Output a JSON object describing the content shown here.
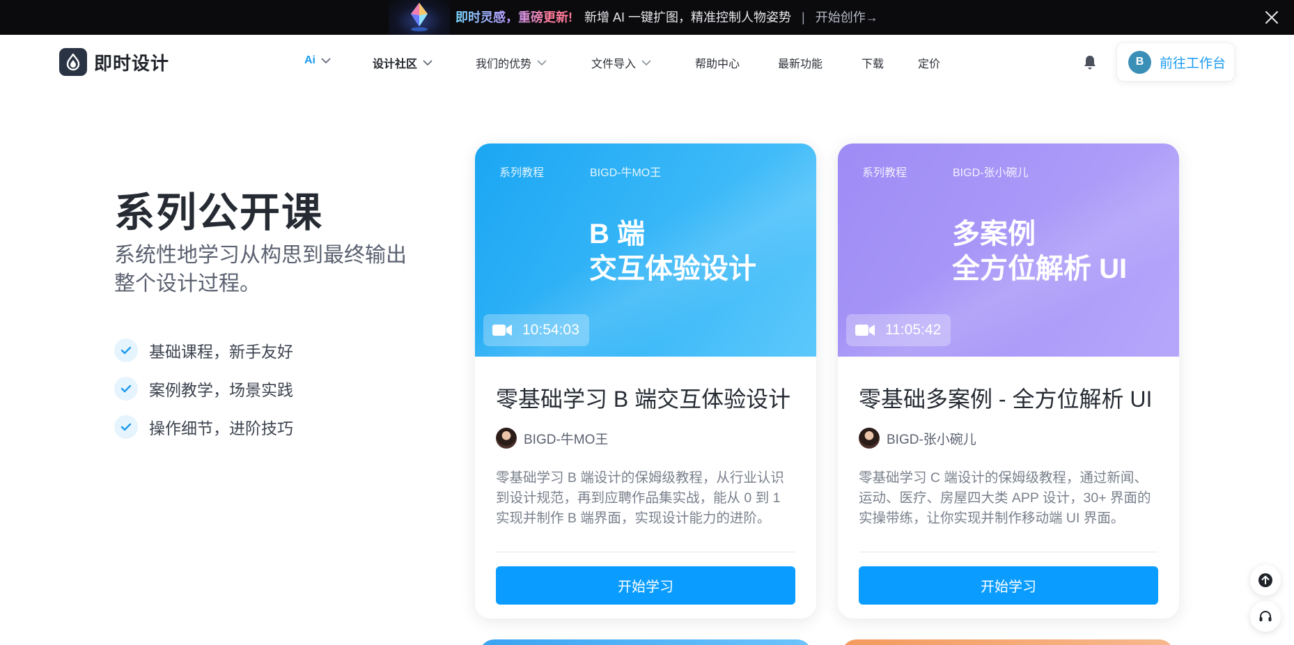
{
  "banner": {
    "highlight": "即时灵感，重磅更新!",
    "message": "新增 AI 一键扩图，精准控制人物姿势",
    "separator": "|",
    "cta": "开始创作→"
  },
  "header": {
    "logo_text": "即时设计",
    "nav": [
      {
        "label": "Ai",
        "dropdown": true
      },
      {
        "label": "设计社区",
        "dropdown": true
      },
      {
        "label": "我们的优势",
        "dropdown": true
      },
      {
        "label": "文件导入",
        "dropdown": true
      },
      {
        "label": "帮助中心",
        "dropdown": false
      },
      {
        "label": "最新功能",
        "dropdown": false
      },
      {
        "label": "下载",
        "dropdown": false
      },
      {
        "label": "定价",
        "dropdown": false
      }
    ],
    "avatar_initial": "B",
    "workspace_label": "前往工作台"
  },
  "intro": {
    "title": "系列公开课",
    "subtitle": "系统性地学习从构思到最终输出整个设计过程。",
    "features": [
      "基础课程，新手友好",
      "案例教学，场景实践",
      "操作细节，进阶技巧"
    ]
  },
  "courses": [
    {
      "tag": "系列教程",
      "tag_author": "BIGD-牛MO王",
      "cover_title": "B 端\n交互体验设计",
      "duration": "10:54:03",
      "title": "零基础学习 B 端交互体验设计",
      "author": "BIGD-牛MO王",
      "description": "零基础学习 B 端设计的保姆级教程，从行业认识到设计规范，再到应聘作品集实战，能从 0 到 1 实现并制作 B 端界面，实现设计能力的进阶。",
      "button": "开始学习",
      "cover_colors": [
        "#1ba6f3",
        "#5cc8fb"
      ]
    },
    {
      "tag": "系列教程",
      "tag_author": "BIGD-张小碗儿",
      "cover_title": "多案例\n全方位解析 UI",
      "duration": "11:05:42",
      "title": "零基础多案例 - 全方位解析 UI",
      "author": "BIGD-张小碗儿",
      "description": "零基础学习 C 端设计的保姆级教程，通过新闻、运动、医疗、房屋四大类 APP 设计，30+ 界面的实操带练，让你实现并制作移动端 UI 界面。",
      "button": "开始学习",
      "cover_colors": [
        "#9e8cf5",
        "#b6a6fb"
      ]
    }
  ]
}
